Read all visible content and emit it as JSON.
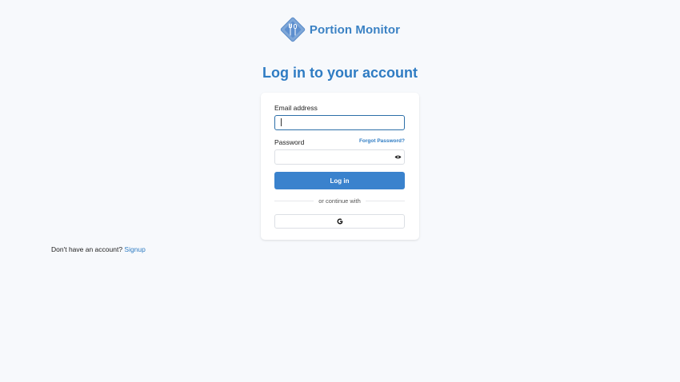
{
  "brand": {
    "name": "Portion Monitor",
    "logo_icon": "fork-spoon-diamond-logo",
    "color": "#3b82c4"
  },
  "heading": "Log in to your account",
  "form": {
    "email_label": "Email address",
    "email_value": "",
    "password_label": "Password",
    "password_value": "",
    "forgot_password": "Forgot Password?",
    "show_password_icon": "eye-icon",
    "login_button": "Log in",
    "divider_text": "or continue with",
    "google_icon": "google-icon"
  },
  "footer": {
    "no_account_text": "Don't have an account?",
    "signup_link": "Signup"
  },
  "colors": {
    "accent": "#3a82cd",
    "background": "#f7f9fc",
    "card": "#ffffff"
  }
}
